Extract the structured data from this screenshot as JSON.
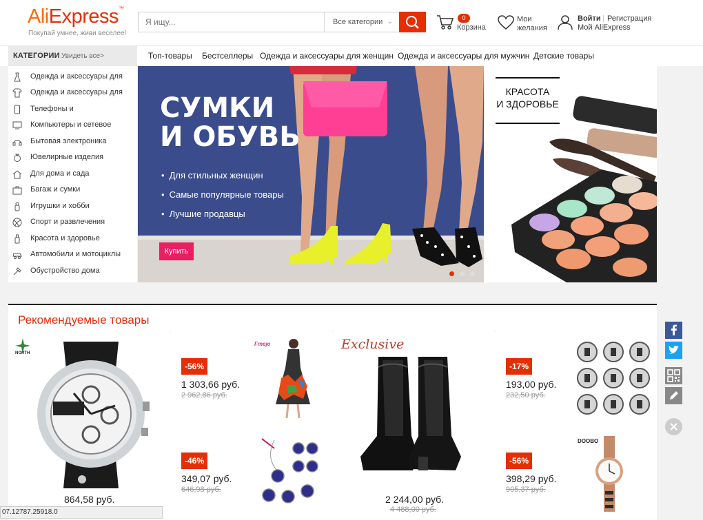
{
  "header": {
    "logo_ali": "Ali",
    "logo_express": "Express",
    "tagline": "Покупай умнее, живи веселее!",
    "search_placeholder": "Я ищу...",
    "search_category": "Все категории",
    "cart_count": "0",
    "cart_label": "Корзина",
    "wishlist_line1": "Мои",
    "wishlist_line2": "желания",
    "login": "Войти",
    "register": "Регистрация",
    "my_aliexpress": "Мой AliExpress"
  },
  "nav": {
    "categories_label": "КАТЕГОРИИ",
    "see_all": "Увидеть все>",
    "links": [
      "Топ-товары",
      "Бестселлеры",
      "Одежда и аксессуары для женщин",
      "Одежда и аксессуары для мужчин",
      "Детские товары"
    ]
  },
  "sidebar": {
    "items": [
      {
        "label": "Одежда и аксессуары для",
        "icon": "dress-icon"
      },
      {
        "label": "Одежда и аксессуары для",
        "icon": "shirt-icon"
      },
      {
        "label": "Телефоны и",
        "icon": "phone-icon"
      },
      {
        "label": "Компьютеры и сетевое",
        "icon": "computer-icon"
      },
      {
        "label": "Бытовая электроника",
        "icon": "headphones-icon"
      },
      {
        "label": "Ювелирные изделия",
        "icon": "ring-icon"
      },
      {
        "label": "Для дома и сада",
        "icon": "house-icon"
      },
      {
        "label": "Багаж и сумки",
        "icon": "bag-icon"
      },
      {
        "label": "Игрушки и хобби",
        "icon": "toy-icon"
      },
      {
        "label": "Спорт и развлечения",
        "icon": "ball-icon"
      },
      {
        "label": "Красота и здоровье",
        "icon": "bottle-icon"
      },
      {
        "label": "Автомобили и мотоциклы",
        "icon": "car-icon"
      },
      {
        "label": "Обустройство дома",
        "icon": "tools-icon"
      }
    ]
  },
  "banner": {
    "title_line1": "СУМКИ",
    "title_line2": "И ОБУВЬ",
    "bullets": [
      "Для стильных женщин",
      "Самые популярные товары",
      "Лучшие продавцы"
    ],
    "buy_button": "Купить",
    "side_title_line1": "КРАСОТА",
    "side_title_line2": "И ЗДОРОВЬЕ"
  },
  "recommended": {
    "title": "Рекомендуемые товары",
    "watch_price": "864,58 руб.",
    "watch_brand": "NORTH",
    "dress_discount": "-56%",
    "dress_price": "1 303,66 руб.",
    "dress_old": "2 962,86 руб.",
    "dress_brand": "Fmejo",
    "jewelry_discount": "-46%",
    "jewelry_price": "349,07 руб.",
    "jewelry_old": "646,98 руб.",
    "exclusive_label": "Exclusive",
    "boots_price": "2 244,00 руб.",
    "boots_old": "4 488,00 руб.",
    "charms_discount": "-17%",
    "charms_price": "193,00 руб.",
    "charms_old": "232,50 руб.",
    "watch2_discount": "-56%",
    "watch2_price": "398,29 руб.",
    "watch2_old": "905,37 руб.",
    "watch2_brand": "DOOBO"
  },
  "status_bar": "07.12787.25918.0",
  "colors": {
    "accent": "#e62e04",
    "orange": "#ff6a00",
    "banner_blue": "#3a4c8c",
    "pink": "#e91e63"
  }
}
